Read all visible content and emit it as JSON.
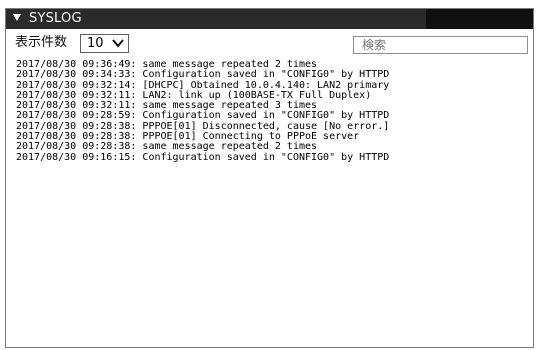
{
  "panel": {
    "title": "SYSLOG"
  },
  "controls": {
    "count_label": "表示件数",
    "count_value": "10",
    "search_placeholder": "検索"
  },
  "log": {
    "lines": [
      "2017/08/30 09:36:49: same message repeated 2 times",
      "2017/08/30 09:34:33: Configuration saved in \"CONFIG0\" by HTTPD",
      "2017/08/30 09:32:14: [DHCPC] Obtained 10.0.4.140: LAN2 primary",
      "2017/08/30 09:32:11: LAN2: link up (100BASE-TX Full Duplex)",
      "2017/08/30 09:32:11: same message repeated 3 times",
      "2017/08/30 09:28:59: Configuration saved in \"CONFIG0\" by HTTPD",
      "2017/08/30 09:28:38: PPPOE[01] Disconnected, cause [No error.]",
      "2017/08/30 09:28:38: PPPOE[01] Connecting to PPPoE server",
      "2017/08/30 09:28:38: same message repeated 2 times",
      "2017/08/30 09:16:15: Configuration saved in \"CONFIG0\" by HTTPD"
    ]
  }
}
